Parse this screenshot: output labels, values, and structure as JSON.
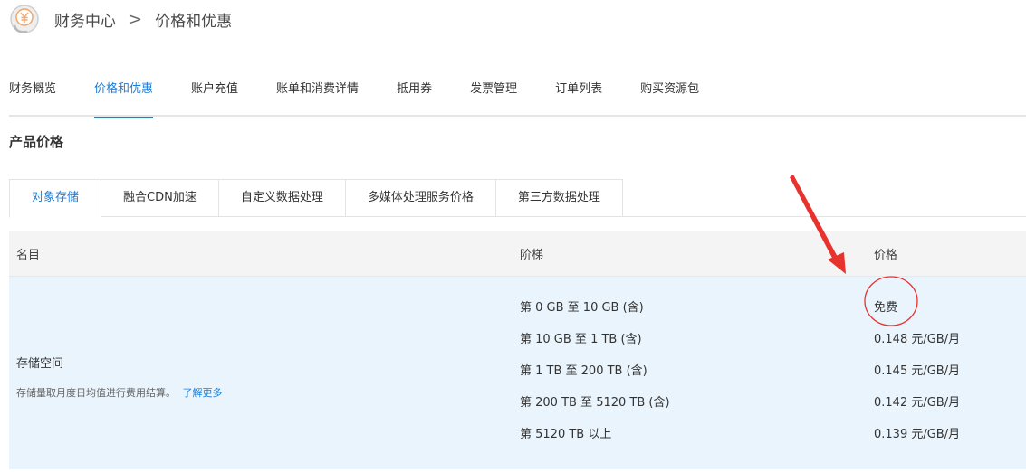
{
  "breadcrumb": {
    "root": "财务中心",
    "separator": ">",
    "current": "价格和优惠"
  },
  "logo_icon": "yen-coin-icon",
  "main_tabs": [
    {
      "label": "财务概览",
      "active": false
    },
    {
      "label": "价格和优惠",
      "active": true
    },
    {
      "label": "账户充值",
      "active": false
    },
    {
      "label": "账单和消费详情",
      "active": false
    },
    {
      "label": "抵用券",
      "active": false
    },
    {
      "label": "发票管理",
      "active": false
    },
    {
      "label": "订单列表",
      "active": false
    },
    {
      "label": "购买资源包",
      "active": false
    }
  ],
  "section_title": "产品价格",
  "sub_tabs": [
    {
      "label": "对象存储",
      "active": true
    },
    {
      "label": "融合CDN加速",
      "active": false
    },
    {
      "label": "自定义数据处理",
      "active": false
    },
    {
      "label": "多媒体处理服务价格",
      "active": false
    },
    {
      "label": "第三方数据处理",
      "active": false
    }
  ],
  "table": {
    "headers": {
      "name": "名目",
      "tier": "阶梯",
      "price": "价格"
    },
    "rows": [
      {
        "name": "存储空间",
        "desc": "存储量取月度日均值进行费用结算。",
        "link": "了解更多",
        "tiers": [
          {
            "tier": "第 0 GB 至 10 GB (含)",
            "price": "免费"
          },
          {
            "tier": "第 10 GB 至 1 TB (含)",
            "price": "0.148 元/GB/月"
          },
          {
            "tier": "第 1 TB 至 200 TB (含)",
            "price": "0.145 元/GB/月"
          },
          {
            "tier": "第 200 TB 至 5120 TB (含)",
            "price": "0.142 元/GB/月"
          },
          {
            "tier": "第 5120 TB 以上",
            "price": "0.139 元/GB/月"
          }
        ]
      }
    ]
  },
  "colors": {
    "accent": "#1f7ed8",
    "row_highlight": "#eaf4fc",
    "annotation": "#e8322e"
  }
}
